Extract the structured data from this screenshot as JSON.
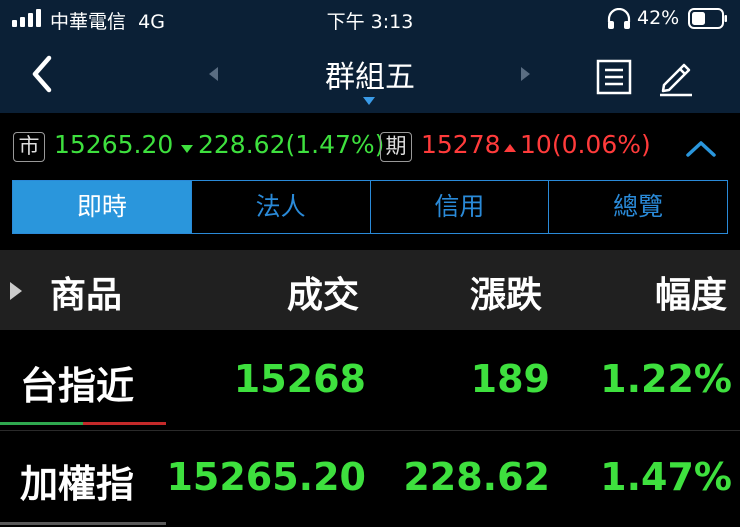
{
  "status_bar": {
    "carrier": "中華電信",
    "network": "4G",
    "time": "下午 3:13",
    "battery": "42%",
    "icons": [
      "signal-icon",
      "headphone-icon",
      "battery-icon"
    ]
  },
  "nav": {
    "title": "群組五",
    "back_icon": "chevron-left-icon",
    "prev_icon": "triangle-left-icon",
    "next_icon": "triangle-right-icon",
    "list_icon": "list-icon",
    "edit_icon": "pencil-icon"
  },
  "quote": {
    "spot_tag": "市",
    "spot_price": "15265.20",
    "spot_change": "228.62",
    "spot_pct": "(1.47%)",
    "futures_tag": "期",
    "futures_price": "15278",
    "futures_change": "10",
    "futures_pct": "(0.06%)"
  },
  "tabs": [
    {
      "label": "即時",
      "active": true
    },
    {
      "label": "法人",
      "active": false
    },
    {
      "label": "信用",
      "active": false
    },
    {
      "label": "總覽",
      "active": false
    }
  ],
  "table": {
    "headers": [
      "商品",
      "成交",
      "漲跌",
      "幅度"
    ],
    "rows": [
      {
        "name": "台指近",
        "price": "15268",
        "change": "189",
        "pct": "1.22%"
      },
      {
        "name": "加權指",
        "price": "15265.20",
        "change": "228.62",
        "pct": "1.47%"
      }
    ]
  },
  "colors": {
    "up": "#3ee03e",
    "down": "#ff3b3b",
    "accent": "#2a96dc",
    "header_bg": "#0b2036"
  }
}
